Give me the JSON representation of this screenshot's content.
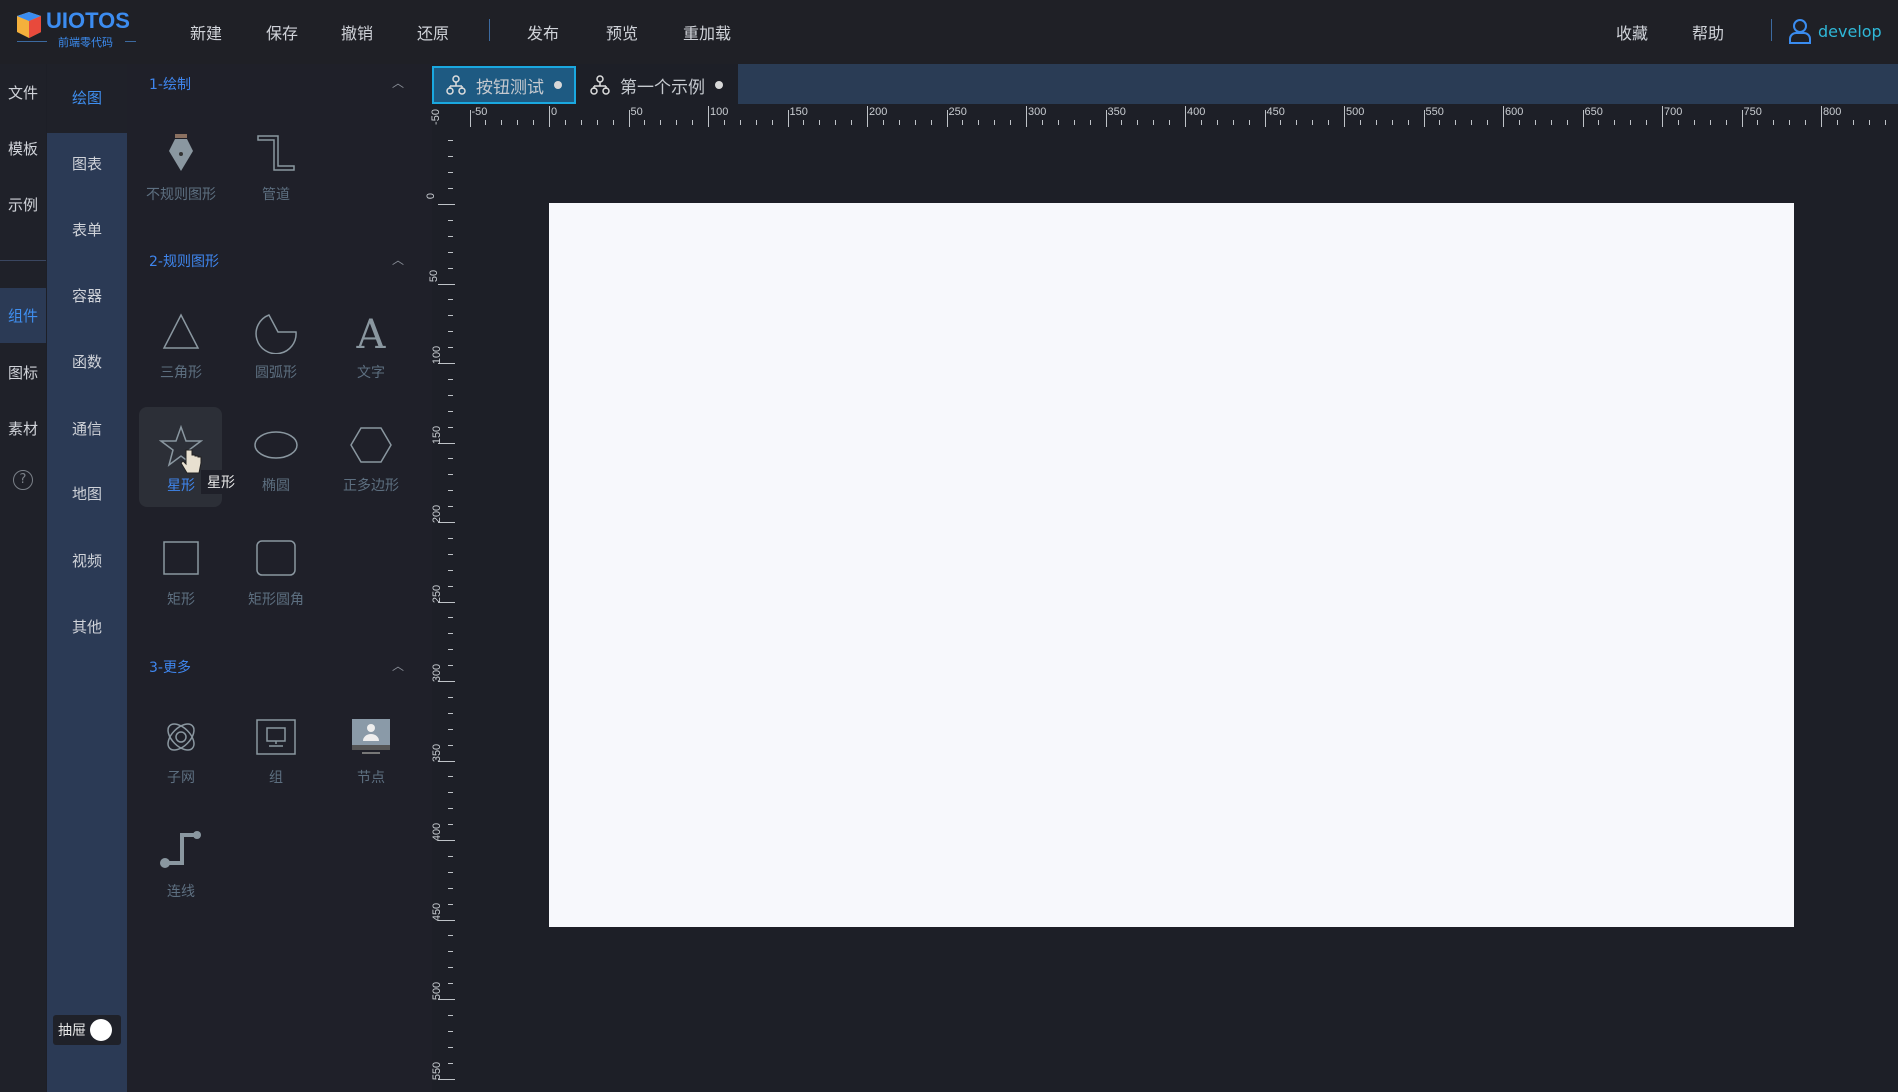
{
  "app": {
    "name": "UIOTOS",
    "subtitle": "前端零代码"
  },
  "header": {
    "menu": [
      "新建",
      "保存",
      "撤销",
      "还原",
      "发布",
      "预览",
      "重加载"
    ],
    "right": [
      "收藏",
      "帮助"
    ],
    "user": "develop"
  },
  "sidebar1": {
    "items": [
      "文件",
      "模板",
      "示例",
      "组件",
      "图标",
      "素材"
    ],
    "active": "组件",
    "help": "?"
  },
  "sidebar2": {
    "items": [
      "绘图",
      "图表",
      "表单",
      "容器",
      "函数",
      "通信",
      "地图",
      "视频",
      "其他"
    ],
    "active": "绘图",
    "drawer_label": "抽屉"
  },
  "palette": {
    "sections": [
      {
        "title": "1-绘制",
        "items": [
          "不规则图形",
          "管道"
        ]
      },
      {
        "title": "2-规则图形",
        "items": [
          "三角形",
          "圆弧形",
          "文字",
          "星形",
          "椭圆",
          "正多边形",
          "矩形",
          "矩形圆角"
        ]
      },
      {
        "title": "3-更多",
        "items": [
          "子网",
          "组",
          "节点",
          "连线"
        ]
      }
    ],
    "hovered": "星形",
    "tooltip": "星形"
  },
  "tabs": [
    {
      "label": "按钮测试",
      "active": true
    },
    {
      "label": "第一个示例",
      "active": false
    }
  ],
  "ruler": {
    "h_labels": [
      -50,
      0,
      50,
      100,
      150,
      200,
      250,
      300,
      350,
      400,
      450,
      500,
      550,
      600,
      650,
      700,
      750,
      800
    ],
    "v_labels": [
      -50,
      0,
      50,
      100,
      150,
      200,
      250,
      300,
      350,
      400,
      450,
      500,
      550
    ]
  },
  "colors": {
    "accent": "#3f86ee",
    "active_tab": "#1e5a82",
    "user": "#2fb8d8"
  }
}
